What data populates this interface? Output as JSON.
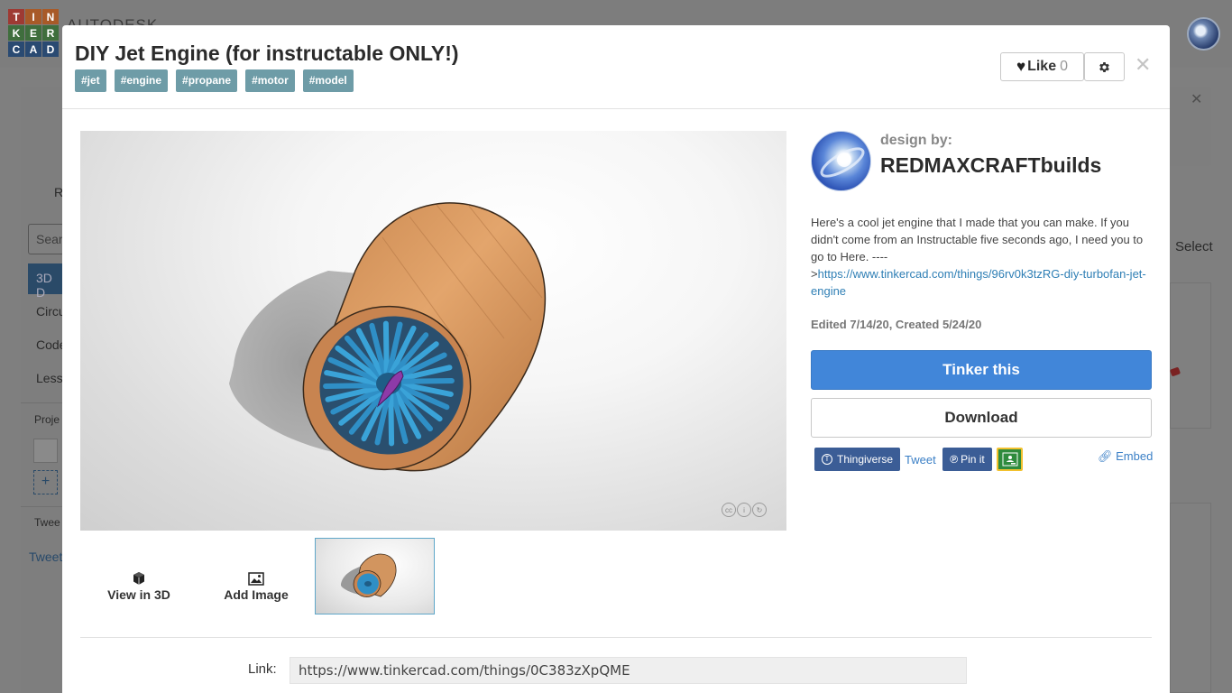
{
  "app": {
    "logo_letters": [
      "T",
      "I",
      "N",
      "K",
      "E",
      "R",
      "C",
      "A",
      "D"
    ],
    "logo_colors": [
      "#c0392b",
      "#d35400",
      "#d35400",
      "#2e7d32",
      "#2e7d32",
      "#2e7d32",
      "#1e4f8a",
      "#1e4f8a",
      "#1e4f8a"
    ],
    "brand": "AUTODESK"
  },
  "background": {
    "partial_tab": "R",
    "search_placeholder": "Sear",
    "sidebar_items": [
      "3D D",
      "Circu",
      "Code",
      "Less"
    ],
    "projects_label": "Proje",
    "add_label": "+",
    "tweet_label": "Twee",
    "tweet_link": "Tweet",
    "select_label": "Select"
  },
  "modal": {
    "title": "DIY Jet Engine (for instructable ONLY!)",
    "tags": [
      "#jet",
      "#engine",
      "#propane",
      "#motor",
      "#model"
    ],
    "like_label": "Like",
    "like_count": "0",
    "close_symbol": "✕"
  },
  "media": {
    "view_3d_label": "View in 3D",
    "add_image_label": "Add Image",
    "license_icons": [
      "cc",
      "by",
      "sa"
    ]
  },
  "author": {
    "design_by_label": "design by:",
    "name": "REDMAXCRAFTbuilds"
  },
  "description": {
    "text": "Here's a cool jet engine that I made that you can make. If you didn't come from an Instructable five seconds ago, I need you to go to Here. ----",
    "link_prefix": ">",
    "link": "https://www.tinkercad.com/things/96rv0k3tzRG-diy-turbofan-jet-engine"
  },
  "meta": "Edited 7/14/20, Created 5/24/20",
  "actions": {
    "tinker_label": "Tinker this",
    "download_label": "Download"
  },
  "share": {
    "thingiverse": "Thingiverse",
    "tweet": "Tweet",
    "pin": "Pin it",
    "embed": "Embed"
  },
  "link": {
    "label": "Link:",
    "value": "https://www.tinkercad.com/things/0C383zXpQME"
  },
  "colors": {
    "primary": "#4186d9",
    "tag": "#6e9ca7",
    "share": "#3b5d96",
    "link": "#2f7fb5",
    "engine_wood": "#d2955f",
    "fan_blue": "#2f8fc6",
    "cone_purple": "#8e3aa8"
  }
}
